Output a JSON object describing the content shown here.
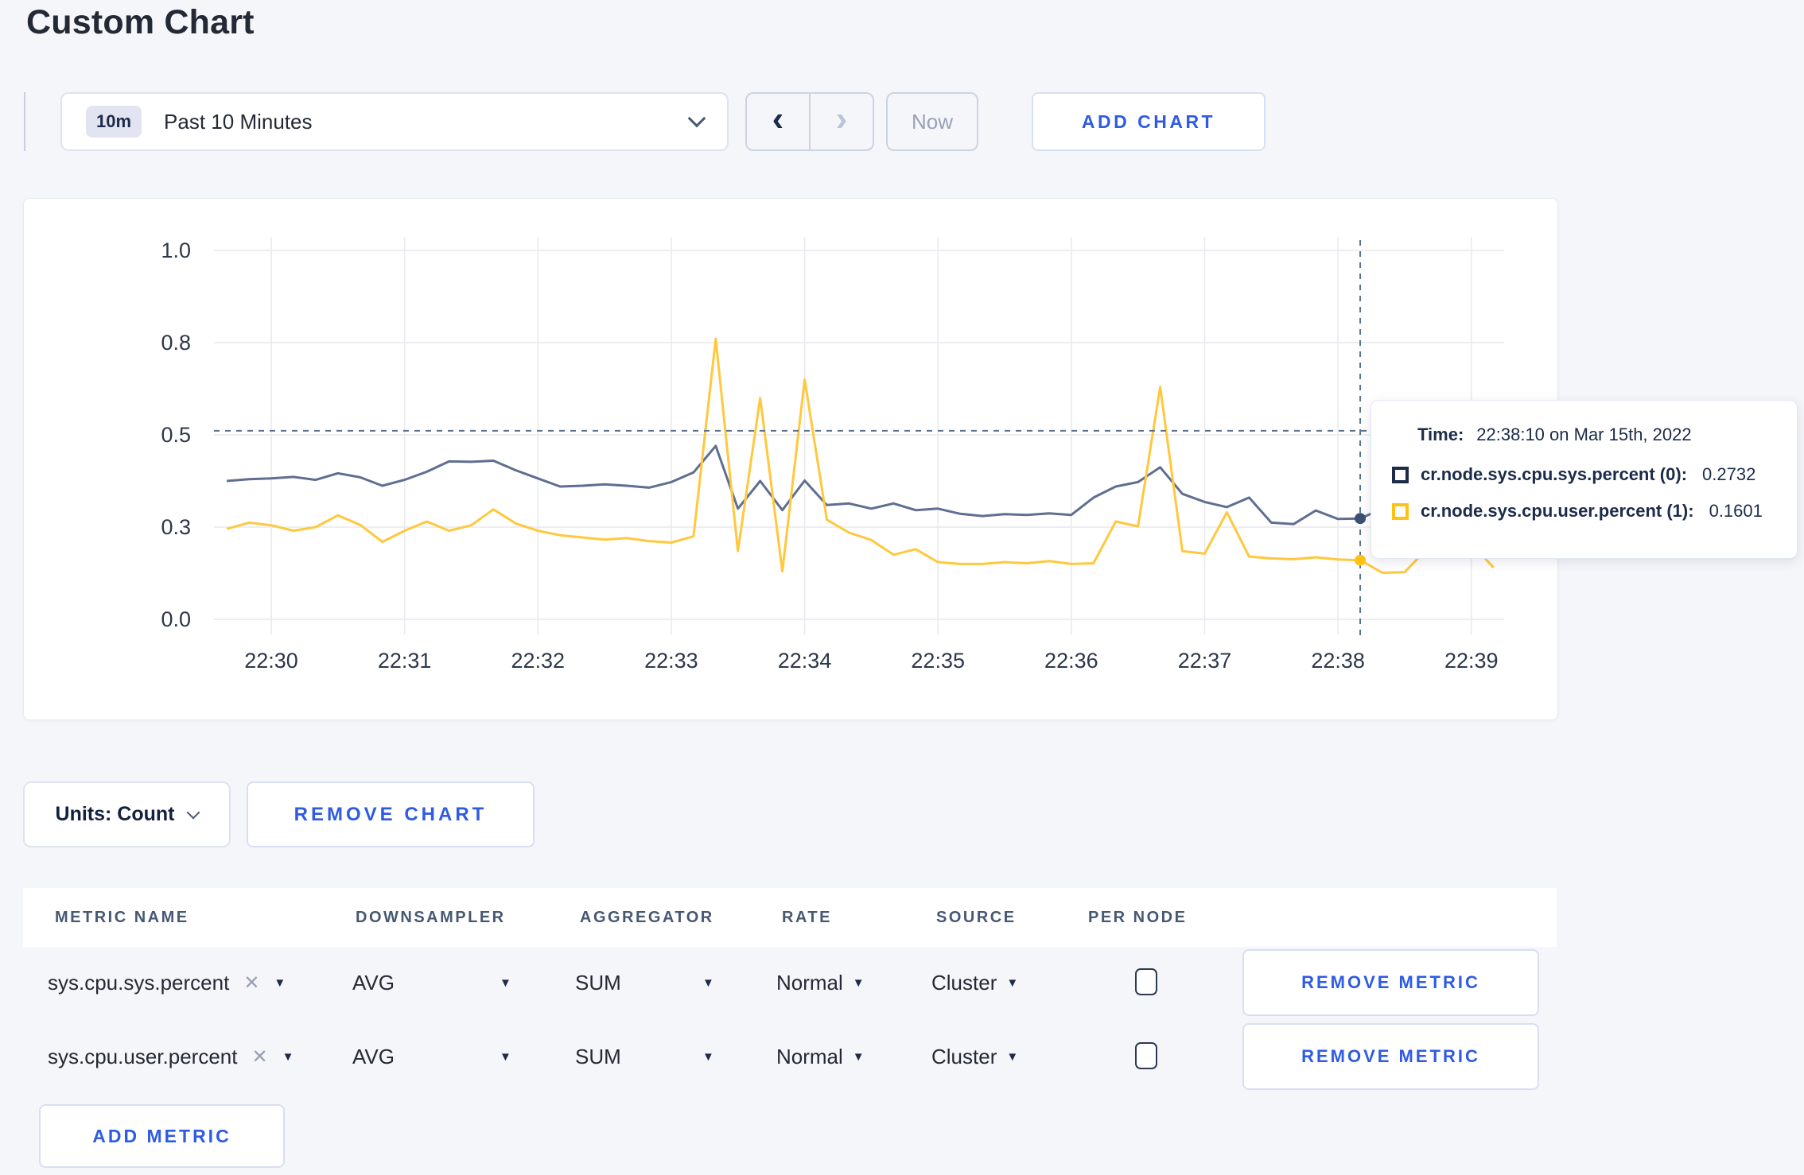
{
  "page": {
    "title": "Custom Chart"
  },
  "icons": {
    "chevron_left": "‹",
    "chevron_right": "›",
    "dropdown_arrow": "▼",
    "remove_x": "✕"
  },
  "toolbar": {
    "time_range": {
      "badge": "10m",
      "label": "Past 10 Minutes"
    },
    "now_label": "Now",
    "add_chart_label": "ADD CHART"
  },
  "chart_tooltip": {
    "time_label": "Time:",
    "time_value": "22:38:10 on Mar 15th, 2022",
    "series": [
      {
        "name": "cr.node.sys.cpu.sys.percent (0):",
        "value": "0.2732",
        "swatch_color": "#1c2b49"
      },
      {
        "name": "cr.node.sys.cpu.user.percent (1):",
        "value": "0.1601",
        "swatch_color": "#ffc113"
      }
    ]
  },
  "chart_controls": {
    "units_label": "Units: Count",
    "remove_chart_label": "REMOVE CHART"
  },
  "metrics_table": {
    "headers": [
      "METRIC NAME",
      "DOWNSAMPLER",
      "AGGREGATOR",
      "RATE",
      "SOURCE",
      "PER NODE"
    ],
    "remove_metric_label": "REMOVE METRIC",
    "add_metric_label": "ADD METRIC",
    "rows": [
      {
        "metric": "sys.cpu.sys.percent",
        "downsampler": "AVG",
        "aggregator": "SUM",
        "rate": "Normal",
        "source": "Cluster",
        "per_node_checked": false
      },
      {
        "metric": "sys.cpu.user.percent",
        "downsampler": "AVG",
        "aggregator": "SUM",
        "rate": "Normal",
        "source": "Cluster",
        "per_node_checked": false
      }
    ]
  },
  "chart_data": {
    "type": "line",
    "title": "",
    "xlabel": "",
    "ylabel": "",
    "ylim": [
      0,
      1
    ],
    "grid": true,
    "x_unit": "seconds since 22:29:40 on Mar 15th, 2022",
    "step_seconds": 10,
    "x_ticks": [
      {
        "t": 20,
        "label": "22:30"
      },
      {
        "t": 80,
        "label": "22:31"
      },
      {
        "t": 140,
        "label": "22:32"
      },
      {
        "t": 200,
        "label": "22:33"
      },
      {
        "t": 260,
        "label": "22:34"
      },
      {
        "t": 320,
        "label": "22:35"
      },
      {
        "t": 380,
        "label": "22:36"
      },
      {
        "t": 440,
        "label": "22:37"
      },
      {
        "t": 500,
        "label": "22:38"
      },
      {
        "t": 560,
        "label": "22:39"
      }
    ],
    "y_ticks": [
      {
        "v": 0,
        "label": "0.0"
      },
      {
        "v": 0.25,
        "label": "0.3"
      },
      {
        "v": 0.5,
        "label": "0.5"
      },
      {
        "v": 0.75,
        "label": "0.8"
      },
      {
        "v": 1,
        "label": "1.0"
      }
    ],
    "series": [
      {
        "name": "cr.node.sys.cpu.sys.percent",
        "color": "#5f6e91",
        "dot_color": "#3d4f73",
        "values": [
          0.375,
          0.38,
          0.382,
          0.386,
          0.378,
          0.396,
          0.385,
          0.362,
          0.378,
          0.4,
          0.428,
          0.427,
          0.43,
          0.404,
          0.382,
          0.36,
          0.362,
          0.366,
          0.362,
          0.357,
          0.372,
          0.398,
          0.47,
          0.3,
          0.375,
          0.296,
          0.376,
          0.31,
          0.314,
          0.3,
          0.314,
          0.296,
          0.3,
          0.286,
          0.28,
          0.285,
          0.283,
          0.287,
          0.283,
          0.33,
          0.36,
          0.372,
          0.412,
          0.34,
          0.318,
          0.304,
          0.33,
          0.262,
          0.258,
          0.295,
          0.272,
          0.2732,
          0.3,
          0.308,
          0.296,
          0.3,
          0.304,
          0.3
        ]
      },
      {
        "name": "cr.node.sys.cpu.user.percent",
        "color": "#ffc83d",
        "dot_color": "#ffc113",
        "values": [
          0.245,
          0.262,
          0.255,
          0.24,
          0.25,
          0.282,
          0.256,
          0.21,
          0.24,
          0.265,
          0.24,
          0.255,
          0.298,
          0.26,
          0.24,
          0.228,
          0.222,
          0.216,
          0.22,
          0.212,
          0.208,
          0.225,
          0.76,
          0.185,
          0.6,
          0.13,
          0.65,
          0.27,
          0.235,
          0.215,
          0.175,
          0.19,
          0.155,
          0.15,
          0.15,
          0.155,
          0.152,
          0.158,
          0.15,
          0.152,
          0.265,
          0.252,
          0.63,
          0.185,
          0.178,
          0.29,
          0.17,
          0.165,
          0.163,
          0.168,
          0.162,
          0.1601,
          0.126,
          0.128,
          0.19,
          0.21,
          0.205,
          0.14
        ]
      }
    ],
    "crosshair": {
      "t": 510,
      "time": "22:38:10",
      "hline_value": 0.511,
      "points": [
        {
          "series": 0,
          "value": 0.2732
        },
        {
          "series": 1,
          "value": 0.1601
        }
      ]
    },
    "legend_position": "tooltip"
  }
}
